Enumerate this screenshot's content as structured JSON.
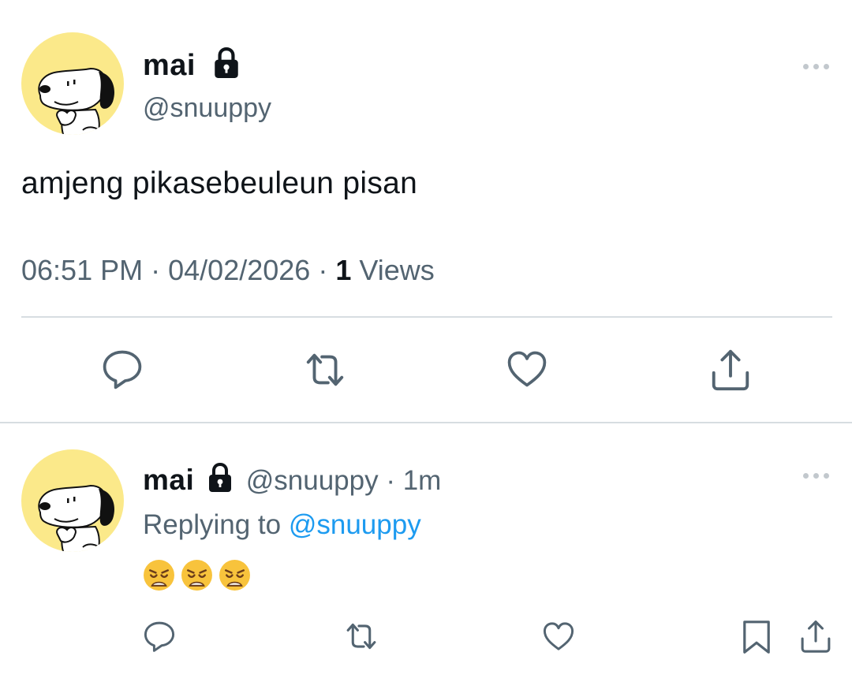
{
  "main_tweet": {
    "display_name": "mai",
    "handle": "@snuuppy",
    "text": "amjeng pikasebeuleun pisan",
    "time": "06:51 PM",
    "separator": "·",
    "date": "04/02/2026",
    "views_count": "1",
    "views_label": "Views"
  },
  "reply": {
    "display_name": "mai",
    "handle": "@snuuppy",
    "separator": "·",
    "time_ago": "1m",
    "replying_to_label": "Replying to",
    "replying_to_handle": "@snuuppy",
    "emoji": [
      "weary-face",
      "weary-face",
      "weary-face"
    ]
  },
  "icons": {
    "avatar": "snoopy-avatar",
    "protected": "lock-icon",
    "more": "more-horizontal-icon",
    "actions": [
      "reply-icon",
      "retweet-icon",
      "like-icon",
      "share-icon",
      "bookmark-icon"
    ]
  },
  "colors": {
    "text": "#0f1419",
    "secondary": "#536471",
    "link": "#1d9bf0",
    "avatar_bg": "#fbe98a",
    "divider": "#d7dde1"
  }
}
